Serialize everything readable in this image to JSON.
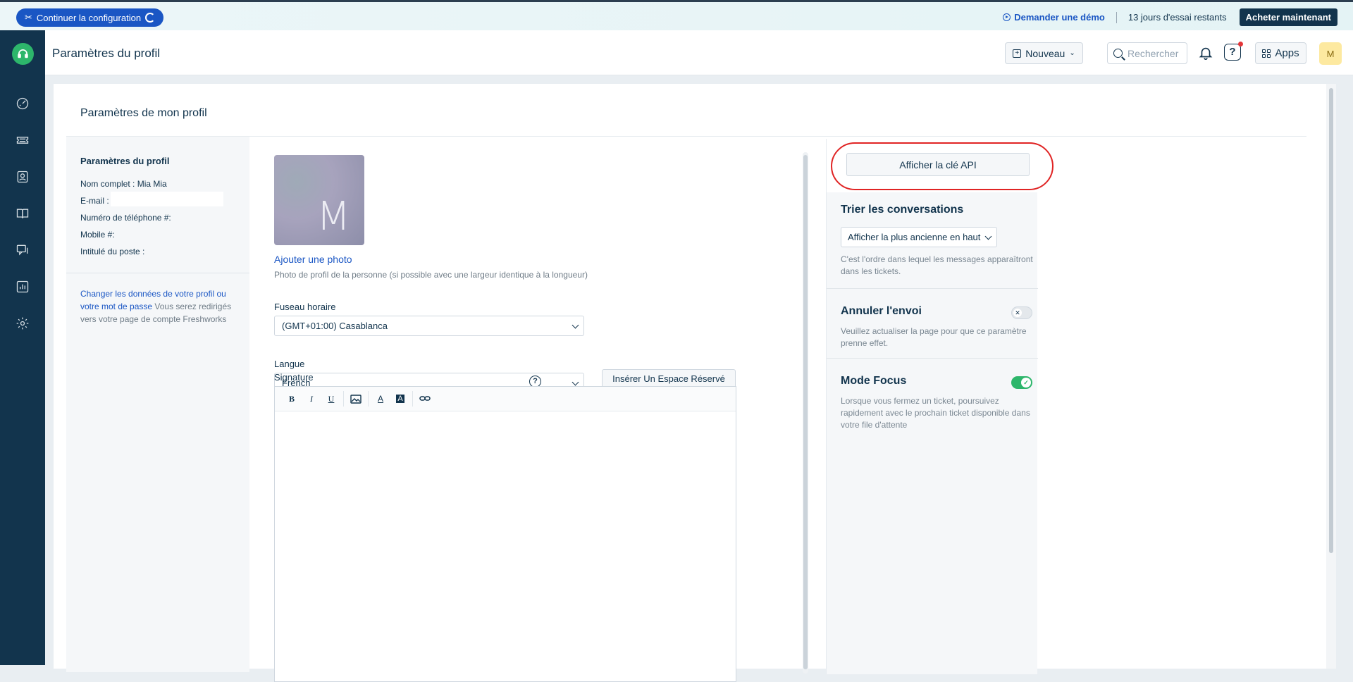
{
  "banner": {
    "config_button": "Continuer la configuration",
    "demo_link": "Demander une démo",
    "trial_text": "13 jours d'essai restants",
    "buy_button": "Acheter maintenant"
  },
  "header": {
    "title": "Paramètres du profil",
    "new_button": "Nouveau",
    "search_placeholder": "Rechercher",
    "apps_button": "Apps",
    "avatar_initial": "M"
  },
  "sidenav": {
    "icons": [
      "headset-logo",
      "dashboard-icon",
      "tickets-icon",
      "contacts-icon",
      "knowledge-base-icon",
      "forums-icon",
      "reports-icon",
      "settings-icon"
    ]
  },
  "card": {
    "title": "Paramètres de mon profil"
  },
  "profile_info": {
    "heading": "Paramètres du profil",
    "full_name_label": "Nom complet :",
    "full_name_value": "Mia Mia",
    "email_label": "E-mail :",
    "phone_label": "Numéro de téléphone #:",
    "mobile_label": "Mobile #:",
    "job_title_label": "Intitulé du poste :",
    "change_link": "Changer les données de votre profil ou votre mot de passe",
    "change_note": "Vous serez redirigés vers votre page de compte Freshworks"
  },
  "form": {
    "avatar_letter": "M",
    "add_photo": "Ajouter une photo",
    "photo_help": "Photo de profil de la personne (si possible avec une largeur identique à la longueur)",
    "timezone_label": "Fuseau horaire",
    "timezone_value": "(GMT+01:00) Casablanca",
    "language_label": "Langue",
    "language_value": "French",
    "signature_label": "Signature",
    "placeholder_button": "Insérer Un Espace Réservé",
    "toolbar": [
      "B",
      "I",
      "U",
      "image-icon",
      "A",
      "A",
      "link-icon"
    ]
  },
  "settings": {
    "api_button": "Afficher la clé API",
    "sort_title": "Trier les conversations",
    "sort_value": "Afficher la plus ancienne en haut",
    "sort_desc": "C'est l'ordre dans lequel les messages apparaîtront dans les tickets.",
    "undo_title": "Annuler l'envoi",
    "undo_desc": "Veuillez actualiser la page pour que ce paramètre prenne effet.",
    "undo_enabled": false,
    "focus_title": "Mode Focus",
    "focus_desc": "Lorsque vous fermez un ticket, poursuivez rapidement avec le prochain ticket disponible dans votre file d'attente",
    "focus_enabled": true
  },
  "colors": {
    "nav_bg": "#12344d",
    "link_blue": "#1a56c4",
    "toggle_on": "#2db66b",
    "highlight_ring": "#e02424"
  }
}
